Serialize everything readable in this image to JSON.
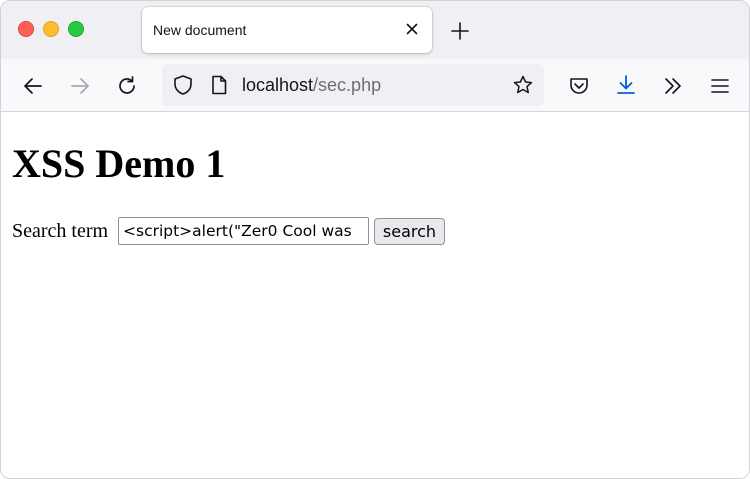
{
  "browser": {
    "tab_title": "New document",
    "url_host": "localhost",
    "url_path": "/sec.php",
    "colors": {
      "close_red": "#fe5f57",
      "minimize_yellow": "#febc2e",
      "zoom_green": "#28c840",
      "download_accent": "#0060df"
    },
    "icons": [
      "back-arrow-icon",
      "forward-arrow-icon",
      "reload-icon",
      "shield-icon",
      "page-icon",
      "star-icon",
      "pocket-icon",
      "download-icon",
      "overflow-icon",
      "menu-icon",
      "close-icon",
      "plus-icon"
    ]
  },
  "page": {
    "heading": "XSS Demo 1",
    "search_label": "Search term",
    "search_value": "<script>alert(\"Zer0 Cool was",
    "search_button": "search"
  }
}
